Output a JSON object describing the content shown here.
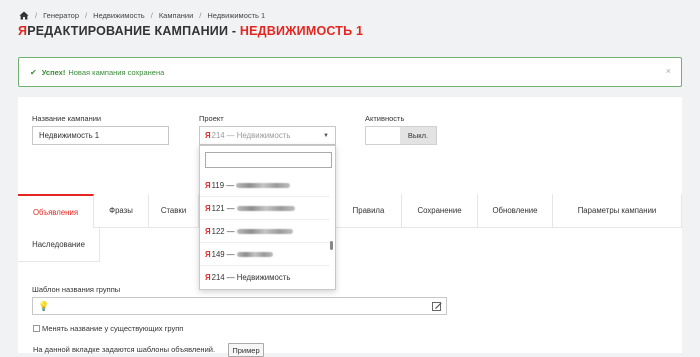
{
  "breadcrumb": {
    "items": [
      "Генератор",
      "Недвижимость",
      "Кампании",
      "Недвижимость 1"
    ],
    "separator": "/"
  },
  "title": {
    "ya_glyph": "Я",
    "main": "РЕДАКТИРОВАНИЕ КАМПАНИИ - ",
    "highlight": "НЕДВИЖИМОСТЬ 1"
  },
  "alert": {
    "strong": "Успех!",
    "message": "Новая кампания сохранена",
    "close": "×",
    "color": "#3c8c3a"
  },
  "form": {
    "campaign_name_label": "Название кампании",
    "campaign_name_value": "Недвижимость 1",
    "project_label": "Проект",
    "project_value": "214 — Недвижимость",
    "activity_label": "Активность",
    "activity_toggle": "Выкл."
  },
  "dropdown": {
    "items": [
      {
        "label": "119 —"
      },
      {
        "label": "121 —"
      },
      {
        "label": "122 —"
      },
      {
        "label": "149 —"
      },
      {
        "label": "214 — Недвижимость"
      }
    ]
  },
  "tabs": {
    "row1": [
      "Объявления",
      "Фразы",
      "Ставки",
      "Правила",
      "Сохранение",
      "Обновление",
      "Параметры кампании"
    ],
    "row2": [
      "Наследование"
    ]
  },
  "template": {
    "label": "Шаблон названия группы",
    "rename_checkbox": "Менять название у существующих групп",
    "hint": "На данной вкладке задаются шаблоны объявлений.",
    "example_button": "Пример"
  },
  "colors": {
    "accent": "#e52620",
    "success": "#3c8c3a"
  }
}
